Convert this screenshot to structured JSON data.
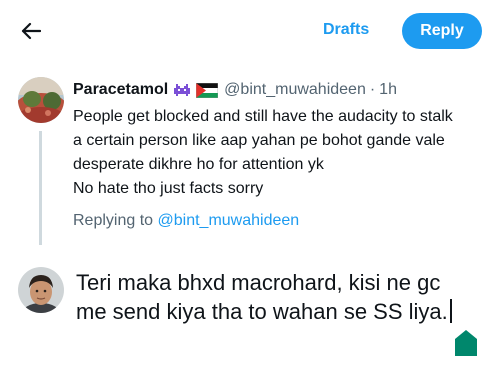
{
  "header": {
    "back_icon": "arrow-left-icon",
    "drafts_label": "Drafts",
    "reply_label": "Reply",
    "accent": "#1d9bf0"
  },
  "tweet": {
    "author_name": "Paracetamol",
    "author_emojis": [
      "alien-monster-icon",
      "palestine-flag-icon"
    ],
    "handle": "@bint_muwahideen",
    "separator": "·",
    "time": "1h",
    "lines": [
      "People get blocked and still have the audacity to stalk",
      "a certain person like aap yahan pe bohot gande vale",
      "desperate dikhre ho for attention yk",
      "No hate tho just facts sorry"
    ]
  },
  "replying_to": {
    "prefix": "Replying to",
    "mention": "@bint_muwahideen"
  },
  "compose": {
    "lines": [
      "Teri maka bhxd macrohard, kisi ne gc",
      "me send kiya tha to wahan se SS liya."
    ],
    "cursor_handle_color": "#00876c"
  }
}
